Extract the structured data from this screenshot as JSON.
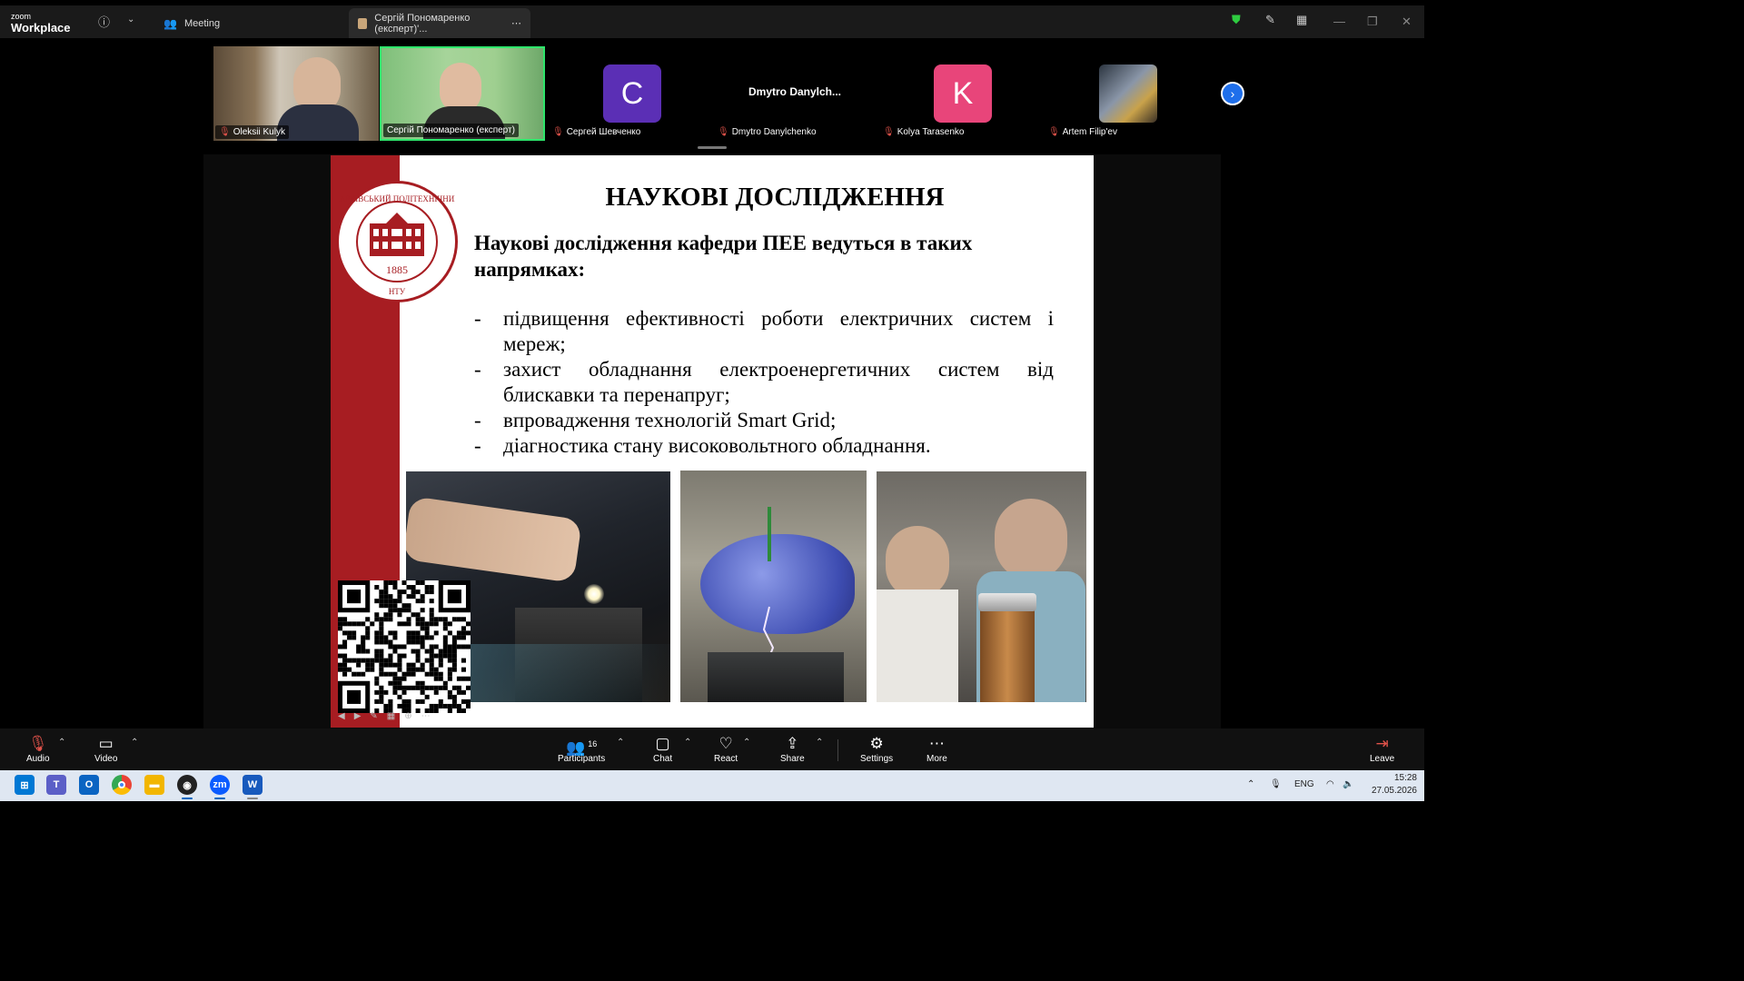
{
  "app": {
    "brand_small": "zoom",
    "brand_big": "Workplace"
  },
  "tabs": [
    {
      "label": "Meeting"
    },
    {
      "label": "Сергій Пономаренко (експерт)'..."
    }
  ],
  "participants": [
    {
      "name": "Oleksii Kulyk",
      "kind": "video"
    },
    {
      "name": "Сергій Пономаренко (експерт)",
      "kind": "video",
      "active": true
    },
    {
      "name": "Сергей Шевченко",
      "kind": "avatar",
      "initial": "C",
      "color": "#5b2fb5"
    },
    {
      "name": "Dmytro Danylchenko",
      "kind": "name",
      "display": "Dmytro  Danylch..."
    },
    {
      "name": "Kolya Tarasenko",
      "kind": "avatar",
      "initial": "K",
      "color": "#e8457a"
    },
    {
      "name": "Artem Filip'ev",
      "kind": "photo"
    }
  ],
  "slide": {
    "title": "НАУКОВІ ДОСЛІДЖЕННЯ",
    "subtitle": "Наукові дослідження кафедри ПЕЕ ведуться в таких напрямках:",
    "bullets": [
      "підвищення ефективності роботи електричних систем і мереж;",
      "захист обладнання електроенергетичних систем від блискавки та перенапруг;",
      "впровадження технологій Smart Grid;",
      "діагностика стану високовольтного обладнання."
    ],
    "seal_year": "1885",
    "accent": "#a71d22"
  },
  "toolbar": {
    "audio": "Audio",
    "video": "Video",
    "participants": "Participants",
    "participants_count": "16",
    "chat": "Chat",
    "react": "React",
    "share": "Share",
    "settings": "Settings",
    "more": "More",
    "leave": "Leave"
  },
  "taskbar": {
    "lang": "ENG",
    "time": "15:28",
    "date": "27.05.2026"
  }
}
